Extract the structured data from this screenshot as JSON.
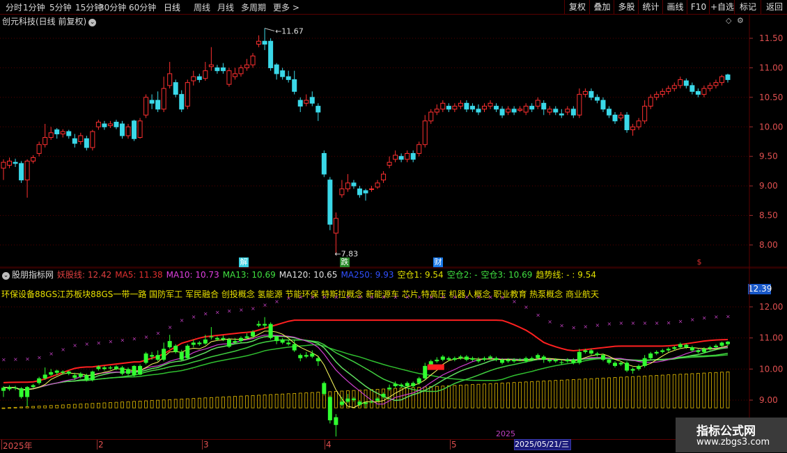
{
  "toolbar": {
    "periods": [
      "分时",
      "1分钟",
      "5分钟",
      "15分钟",
      "30分钟",
      "60分钟",
      "日线",
      "周线",
      "月线",
      "多周期",
      "更多 >"
    ],
    "right_buttons": [
      "复权",
      "叠加",
      "多股",
      "统计",
      "画线",
      "F10",
      "+自选",
      "标记",
      "返回"
    ]
  },
  "main_chart": {
    "title": "创元科技(日线 前复权)",
    "high_label": "11.67",
    "low_label": "7.83",
    "y_ticks": [
      "11.50",
      "11.00",
      "10.50",
      "10.00",
      "9.50",
      "9.00",
      "8.50",
      "8.00"
    ],
    "events": [
      {
        "label": "解",
        "color": "#3ad0e0"
      },
      {
        "label": "跌",
        "color": "#2a8a2a"
      },
      {
        "label": "财",
        "color": "#1878e8"
      },
      {
        "label": "$",
        "color": "#e03030"
      }
    ]
  },
  "indicator": {
    "name": "股朋指标网",
    "values": [
      {
        "label": "妖股线: 12.42",
        "color": "#e04040"
      },
      {
        "label": "MA5: 11.38",
        "color": "#e03030"
      },
      {
        "label": "MA10: 10.73",
        "color": "#e040e0"
      },
      {
        "label": "MA13: 10.69",
        "color": "#40e040"
      },
      {
        "label": "MA120: 10.65",
        "color": "#e0e0e0"
      },
      {
        "label": "MA250: 9.93",
        "color": "#3050ff"
      },
      {
        "label": "空仓1: 9.54",
        "color": "#e0e000"
      },
      {
        "label": "空仓2: -",
        "color": "#40e040"
      },
      {
        "label": "空仓3: 10.69",
        "color": "#40e040"
      },
      {
        "label": "趋势线: - : 9.54",
        "color": "#e0e000"
      }
    ],
    "concepts": "环保设备88GS江苏板块88GS一带一路 国防军工 军民融合 创投概念 氢能源 节能环保 特斯拉概念 新能源车 芯片 特高压 机器人概念 职业教育 热泵概念 商业航天",
    "current_value": "12.39",
    "y_ticks": [
      "12.00",
      "11.00",
      "10.00",
      "9.00"
    ]
  },
  "date_axis": {
    "labels": [
      "2025年",
      "2",
      "3",
      "4",
      "5"
    ],
    "year_label": "2025",
    "cursor_date": "2025/05/21/三"
  },
  "watermark": {
    "line1": "指标公式网",
    "line2": "www.zbgs3.com"
  },
  "chart_data": {
    "type": "candlestick",
    "ylim": [
      7.7,
      11.8
    ],
    "candles": [
      [
        9.3,
        9.4,
        9.1,
        9.45
      ],
      [
        9.35,
        9.42,
        9.3,
        9.48
      ],
      [
        9.4,
        9.38,
        9.32,
        9.46
      ],
      [
        9.38,
        9.1,
        9.05,
        9.42
      ],
      [
        9.1,
        9.42,
        8.8,
        9.45
      ],
      [
        9.42,
        9.48,
        9.38,
        9.52
      ],
      [
        9.55,
        9.7,
        9.5,
        9.75
      ],
      [
        9.7,
        9.82,
        9.65,
        10.05
      ],
      [
        9.82,
        9.9,
        9.78,
        10.0
      ],
      [
        9.95,
        9.88,
        9.8,
        9.98
      ],
      [
        9.88,
        9.92,
        9.82,
        9.96
      ],
      [
        9.92,
        9.85,
        9.8,
        9.95
      ],
      [
        9.8,
        9.72,
        9.65,
        9.88
      ],
      [
        9.75,
        9.85,
        9.7,
        9.9
      ],
      [
        9.8,
        9.65,
        9.6,
        9.85
      ],
      [
        9.65,
        9.92,
        9.6,
        9.95
      ],
      [
        10.0,
        10.08,
        9.95,
        10.12
      ],
      [
        10.05,
        10.0,
        9.95,
        10.1
      ],
      [
        10.02,
        10.05,
        9.98,
        10.1
      ],
      [
        10.08,
        10.0,
        9.96,
        10.12
      ],
      [
        10.05,
        9.85,
        9.8,
        10.1
      ],
      [
        9.85,
        10.0,
        9.8,
        10.05
      ],
      [
        10.1,
        9.8,
        9.76,
        10.12
      ],
      [
        9.82,
        10.1,
        9.8,
        10.15
      ],
      [
        10.2,
        10.5,
        10.15,
        10.55
      ],
      [
        10.45,
        10.4,
        10.3,
        10.55
      ],
      [
        10.45,
        10.3,
        10.25,
        10.6
      ],
      [
        10.3,
        10.65,
        10.25,
        10.85
      ],
      [
        10.7,
        10.9,
        10.65,
        11.1
      ],
      [
        10.75,
        10.55,
        10.5,
        10.8
      ],
      [
        10.55,
        10.3,
        10.25,
        10.62
      ],
      [
        10.35,
        10.75,
        10.3,
        10.8
      ],
      [
        10.78,
        10.85,
        10.7,
        10.95
      ],
      [
        10.85,
        10.8,
        10.75,
        10.9
      ],
      [
        10.82,
        10.95,
        10.78,
        11.1
      ],
      [
        11.02,
        11.05,
        10.95,
        11.35
      ],
      [
        11.0,
        10.95,
        10.9,
        11.05
      ],
      [
        11.0,
        10.95,
        10.9,
        11.08
      ],
      [
        10.72,
        10.95,
        10.68,
        11.0
      ],
      [
        10.85,
        10.9,
        10.8,
        11.0
      ],
      [
        10.9,
        11.0,
        10.85,
        11.05
      ],
      [
        11.0,
        11.05,
        10.95,
        11.15
      ],
      [
        11.05,
        11.2,
        11.0,
        11.25
      ],
      [
        11.4,
        11.45,
        11.35,
        11.55
      ],
      [
        11.45,
        11.4,
        11.3,
        11.67
      ],
      [
        11.45,
        11.0,
        10.95,
        11.5
      ],
      [
        11.05,
        10.9,
        10.8,
        11.08
      ],
      [
        10.95,
        10.85,
        10.8,
        11.0
      ],
      [
        10.85,
        10.8,
        10.75,
        10.95
      ],
      [
        10.8,
        10.6,
        10.55,
        10.95
      ],
      [
        10.45,
        10.35,
        10.25,
        10.5
      ],
      [
        10.4,
        10.45,
        10.35,
        10.55
      ],
      [
        10.5,
        10.4,
        10.35,
        10.6
      ],
      [
        10.35,
        10.25,
        10.1,
        10.4
      ],
      [
        9.55,
        9.2,
        9.15,
        9.6
      ],
      [
        9.1,
        8.35,
        8.25,
        9.15
      ],
      [
        8.2,
        8.45,
        7.83,
        8.55
      ],
      [
        8.85,
        8.95,
        8.8,
        9.1
      ],
      [
        8.95,
        9.05,
        8.9,
        9.2
      ],
      [
        9.05,
        9.0,
        8.95,
        9.1
      ],
      [
        8.95,
        8.85,
        8.8,
        9.0
      ],
      [
        8.92,
        8.88,
        8.75,
        8.95
      ],
      [
        8.95,
        8.95,
        8.9,
        9.0
      ],
      [
        8.98,
        9.05,
        8.95,
        9.1
      ],
      [
        9.1,
        9.2,
        9.05,
        9.25
      ],
      [
        9.35,
        9.4,
        9.3,
        9.5
      ],
      [
        9.45,
        9.52,
        9.4,
        9.6
      ],
      [
        9.5,
        9.45,
        9.4,
        9.55
      ],
      [
        9.45,
        9.55,
        9.4,
        9.6
      ],
      [
        9.55,
        9.45,
        9.4,
        9.6
      ],
      [
        9.55,
        9.7,
        9.5,
        9.75
      ],
      [
        9.7,
        10.1,
        9.65,
        10.2
      ],
      [
        10.1,
        10.25,
        10.05,
        10.3
      ],
      [
        10.25,
        10.3,
        10.2,
        10.38
      ],
      [
        10.3,
        10.4,
        10.25,
        10.45
      ],
      [
        10.35,
        10.3,
        10.25,
        10.4
      ],
      [
        10.3,
        10.35,
        10.25,
        10.4
      ],
      [
        10.35,
        10.4,
        10.3,
        10.45
      ],
      [
        10.4,
        10.3,
        10.25,
        10.45
      ],
      [
        10.35,
        10.3,
        10.25,
        10.4
      ],
      [
        10.3,
        10.25,
        10.2,
        10.38
      ],
      [
        10.3,
        10.35,
        10.25,
        10.4
      ],
      [
        10.35,
        10.4,
        10.3,
        10.45
      ],
      [
        10.35,
        10.3,
        10.25,
        10.4
      ],
      [
        10.3,
        10.2,
        10.15,
        10.35
      ],
      [
        10.25,
        10.3,
        10.2,
        10.35
      ],
      [
        10.3,
        10.25,
        10.2,
        10.35
      ],
      [
        10.28,
        10.3,
        10.25,
        10.35
      ],
      [
        10.25,
        10.35,
        10.2,
        10.4
      ],
      [
        10.35,
        10.3,
        10.25,
        10.4
      ],
      [
        10.35,
        10.45,
        10.3,
        10.5
      ],
      [
        10.4,
        10.3,
        10.2,
        10.45
      ],
      [
        10.25,
        10.3,
        10.2,
        10.35
      ],
      [
        10.3,
        10.25,
        10.2,
        10.35
      ],
      [
        10.22,
        10.2,
        10.15,
        10.3
      ],
      [
        10.25,
        10.3,
        10.2,
        10.35
      ],
      [
        10.3,
        10.2,
        10.15,
        10.35
      ],
      [
        10.2,
        10.55,
        10.15,
        10.65
      ],
      [
        10.55,
        10.6,
        10.5,
        10.65
      ],
      [
        10.6,
        10.5,
        10.45,
        10.65
      ],
      [
        10.5,
        10.45,
        10.4,
        10.55
      ],
      [
        10.45,
        10.3,
        10.25,
        10.5
      ],
      [
        10.3,
        10.2,
        10.15,
        10.35
      ],
      [
        10.2,
        10.1,
        10.05,
        10.25
      ],
      [
        10.15,
        10.2,
        10.1,
        10.25
      ],
      [
        10.2,
        9.95,
        9.9,
        10.25
      ],
      [
        9.95,
        10.0,
        9.85,
        10.05
      ],
      [
        10.0,
        10.1,
        9.95,
        10.15
      ],
      [
        10.1,
        10.35,
        10.05,
        10.45
      ],
      [
        10.35,
        10.5,
        10.3,
        10.55
      ],
      [
        10.5,
        10.55,
        10.45,
        10.6
      ],
      [
        10.55,
        10.6,
        10.5,
        10.65
      ],
      [
        10.6,
        10.65,
        10.55,
        10.7
      ],
      [
        10.65,
        10.7,
        10.6,
        10.75
      ],
      [
        10.7,
        10.8,
        10.65,
        10.85
      ],
      [
        10.78,
        10.7,
        10.65,
        10.82
      ],
      [
        10.7,
        10.6,
        10.55,
        10.75
      ],
      [
        10.6,
        10.55,
        10.5,
        10.65
      ],
      [
        10.55,
        10.65,
        10.5,
        10.7
      ],
      [
        10.65,
        10.7,
        10.6,
        10.75
      ],
      [
        10.7,
        10.75,
        10.65,
        10.8
      ],
      [
        10.75,
        10.85,
        10.7,
        10.88
      ],
      [
        10.88,
        10.8,
        10.75,
        10.9
      ]
    ]
  }
}
